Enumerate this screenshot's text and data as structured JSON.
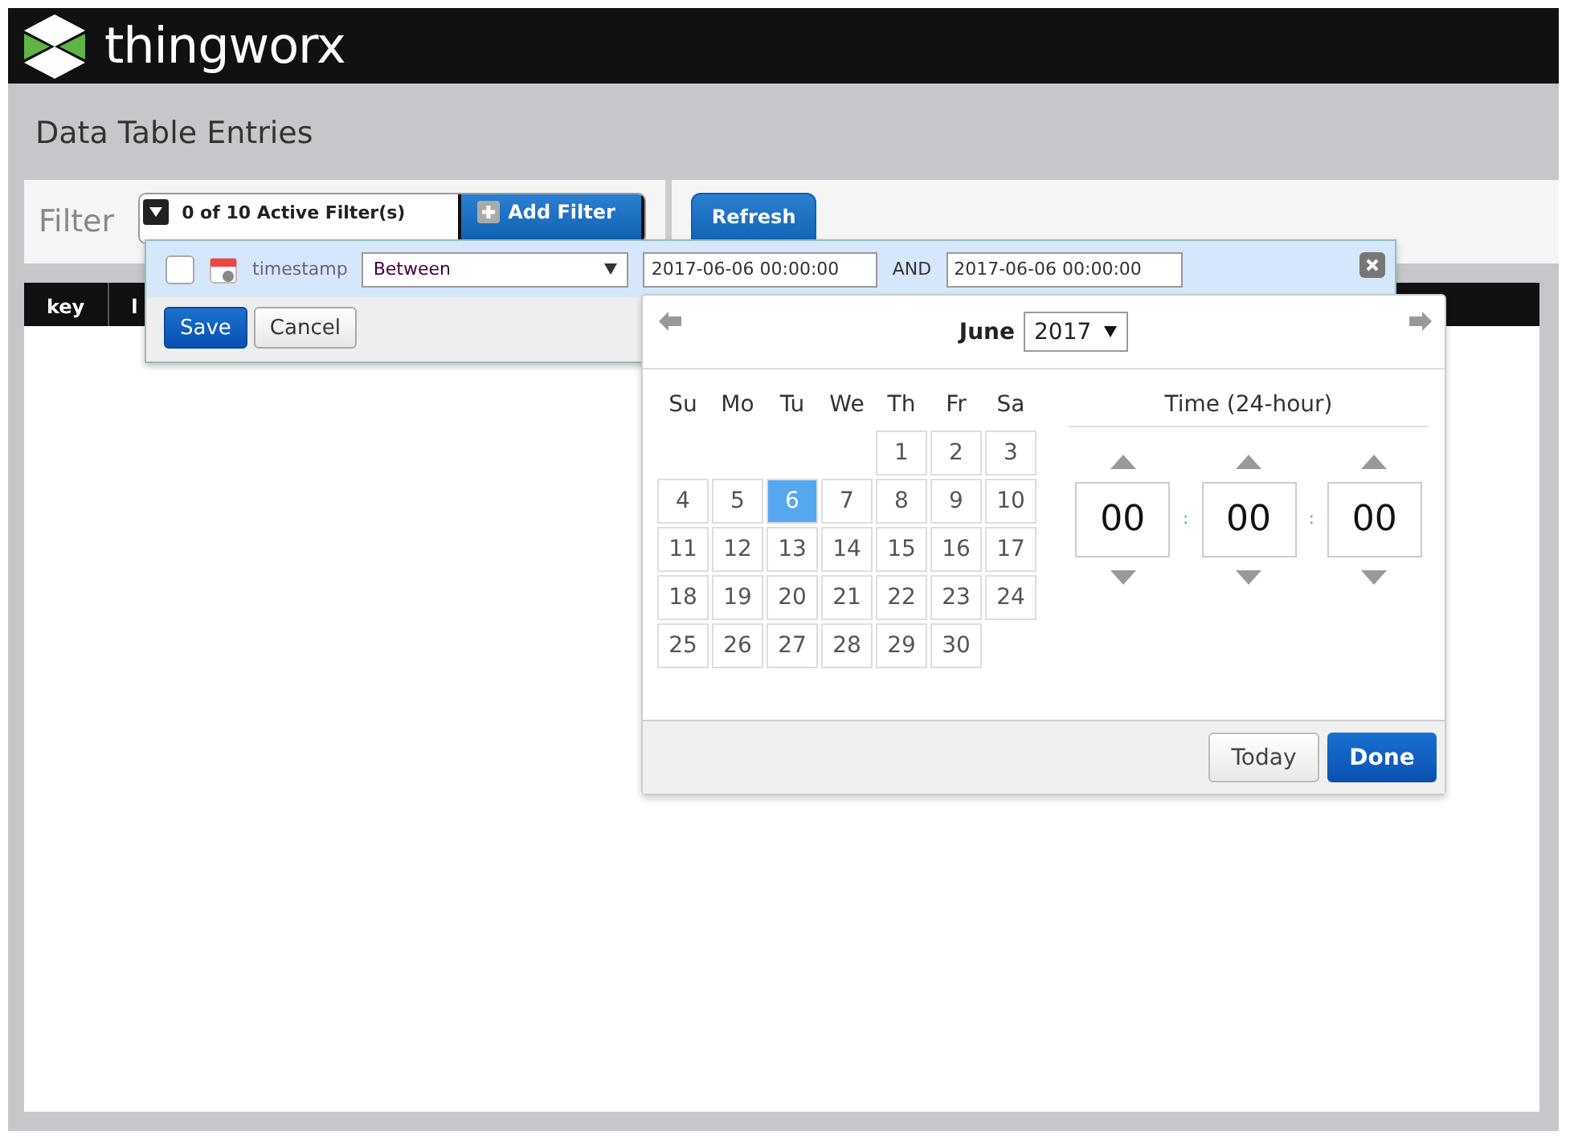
{
  "header": {
    "logo_text": "thingworx"
  },
  "page_title": "Data Table Entries",
  "filter_bar": {
    "label": "Filter",
    "filters_toggle": "0 of 10 Active Filter(s)",
    "add_filter": "Add Filter",
    "refresh": "Refresh"
  },
  "table": {
    "columns": [
      "key",
      "l"
    ]
  },
  "filter_row": {
    "checked": false,
    "field": "timestamp",
    "operator": "Between",
    "from_value": "2017-06-06 00:00:00",
    "joiner": "AND",
    "to_value": "2017-06-06 00:00:00",
    "save": "Save",
    "cancel": "Cancel"
  },
  "date_picker": {
    "month": "June",
    "year": "2017",
    "weekdays": [
      "Su",
      "Mo",
      "Tu",
      "We",
      "Th",
      "Fr",
      "Sa"
    ],
    "weeks": [
      [
        {
          "label": "1",
          "selected": false
        },
        {
          "label": "2",
          "selected": false
        },
        {
          "label": "3",
          "selected": false
        }
      ],
      [
        {
          "label": "4",
          "selected": false
        },
        {
          "label": "5",
          "selected": false
        },
        {
          "label": "6",
          "selected": true
        },
        {
          "label": "7",
          "selected": false
        },
        {
          "label": "8",
          "selected": false
        },
        {
          "label": "9",
          "selected": false
        },
        {
          "label": "10",
          "selected": false
        }
      ],
      [
        {
          "label": "11",
          "selected": false
        },
        {
          "label": "12",
          "selected": false
        },
        {
          "label": "13",
          "selected": false
        },
        {
          "label": "14",
          "selected": false
        },
        {
          "label": "15",
          "selected": false
        },
        {
          "label": "16",
          "selected": false
        },
        {
          "label": "17",
          "selected": false
        }
      ],
      [
        {
          "label": "18",
          "selected": false
        },
        {
          "label": "19",
          "selected": false
        },
        {
          "label": "20",
          "selected": false
        },
        {
          "label": "21",
          "selected": false
        },
        {
          "label": "22",
          "selected": false
        },
        {
          "label": "23",
          "selected": false
        },
        {
          "label": "24",
          "selected": false
        }
      ],
      [
        {
          "label": "25",
          "selected": false
        },
        {
          "label": "26",
          "selected": false
        },
        {
          "label": "27",
          "selected": false
        },
        {
          "label": "28",
          "selected": false
        },
        {
          "label": "29",
          "selected": false
        },
        {
          "label": "30",
          "selected": false
        }
      ]
    ],
    "time_title": "Time (24-hour)",
    "time_parts": [
      "00",
      "00",
      "00"
    ],
    "separators": [
      ":",
      ":"
    ],
    "today": "Today",
    "done": "Done"
  }
}
